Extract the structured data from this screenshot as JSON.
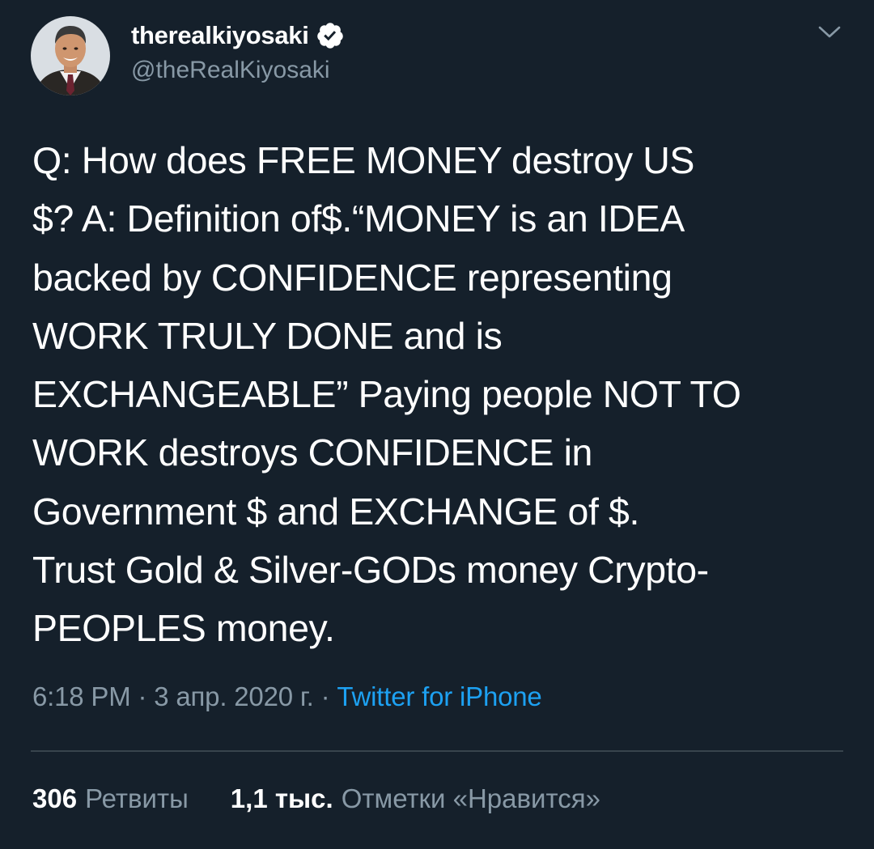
{
  "author": {
    "display_name": "therealkiyosaki",
    "handle": "@theRealKiyosaki",
    "verified": true
  },
  "tweet": {
    "lines": [
      "Q: How does FREE MONEY destroy US",
      "$? A: Definition of$.“MONEY is an IDEA",
      "backed by CONFIDENCE representing",
      "WORK TRULY DONE and is",
      "EXCHANGEABLE” Paying people NOT TO",
      "WORK destroys CONFIDENCE in",
      "Government $ and EXCHANGE of $.",
      "Trust Gold & Silver-GODs money Crypto-",
      "PEOPLES money."
    ]
  },
  "meta": {
    "time": "6:18 PM",
    "sep1": " · ",
    "date": "3 апр. 2020 г.",
    "sep2": " · ",
    "source": "Twitter for iPhone"
  },
  "stats": {
    "retweets_count": "306",
    "retweets_label": "Ретвиты",
    "likes_count": "1,1 тыс.",
    "likes_label": "Отметки «Нравится»"
  },
  "icons": {
    "verified": "verified-badge-icon",
    "caret": "chevron-down-icon"
  },
  "colors": {
    "background": "#15202b",
    "text": "#ffffff",
    "secondary": "#8899a6",
    "link": "#1da1f2",
    "divider": "#38444d"
  }
}
